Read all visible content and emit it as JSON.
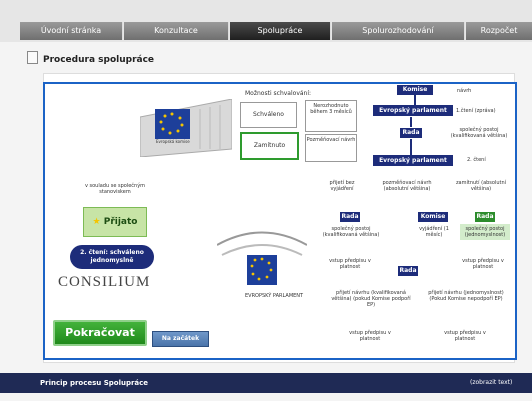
{
  "nav": {
    "tabs": [
      "Úvodní stránka",
      "Konzultace",
      "Spolupráce",
      "Spolurozhodování",
      "Rozpočet"
    ],
    "active_index": 2
  },
  "page": {
    "title": "Procedura spolupráce"
  },
  "diagram": {
    "approval_options_title": "Možnosti schvalování:",
    "approval_options": [
      "Schváleno",
      "Nerozhodnuto během 3 měsíců",
      "Zamítnuto",
      "Pozměňovací návrh"
    ],
    "ec_caption": "Evropská komise",
    "consilium_text": "CONSILIUM",
    "parliament_caption": "EVROPSKÝ PARLAMENT",
    "left_note": "v souladu se společným stanoviskem",
    "prijato": "Přijato",
    "second_reading_badge": "2. čtení: schváleno jednomyslně",
    "flow": {
      "komise": "Komise",
      "navrh": "návrh",
      "ep": "Evropský parlament",
      "first_reading": "1.čtení (zpráva)",
      "rada": "Rada",
      "common_position": "společný postoj (kvalifikovaná většina)",
      "second_reading": "2. čtení",
      "prijeti_bez": "přijetí bez vyjádření",
      "pozmenovaci": "pozměňovací návrh (absolutní většina)",
      "zamitnuti": "zamítnutí (absolutní většina)",
      "rada_left_text": "společný postoj (kvalifikovaná většina)",
      "komise_mid_text": "vyjádření (1 měsíc)",
      "rada_right_text": "společný postoj (jednomyslnost)",
      "vstup_left": "vstup předpisu v platnost",
      "vstup_right": "vstup předpisu v platnost",
      "prijeti_kval": "přijetí návrhu (kvalifikovaná většina) (pokud Komise podpoří EP)",
      "prijeti_jedn": "přijetí návrhu (jednomyslnost) (Pokud Komise nepodpoří EP)",
      "vstup_bottom_left": "vstup předpisu v platnost",
      "vstup_bottom_right": "vstup předpisu v platnost"
    }
  },
  "buttons": {
    "continue": "Pokračovat",
    "to_start": "Na začátek"
  },
  "footer": {
    "label": "Princip procesu Spolupráce",
    "action": "(zobrazit text)"
  }
}
